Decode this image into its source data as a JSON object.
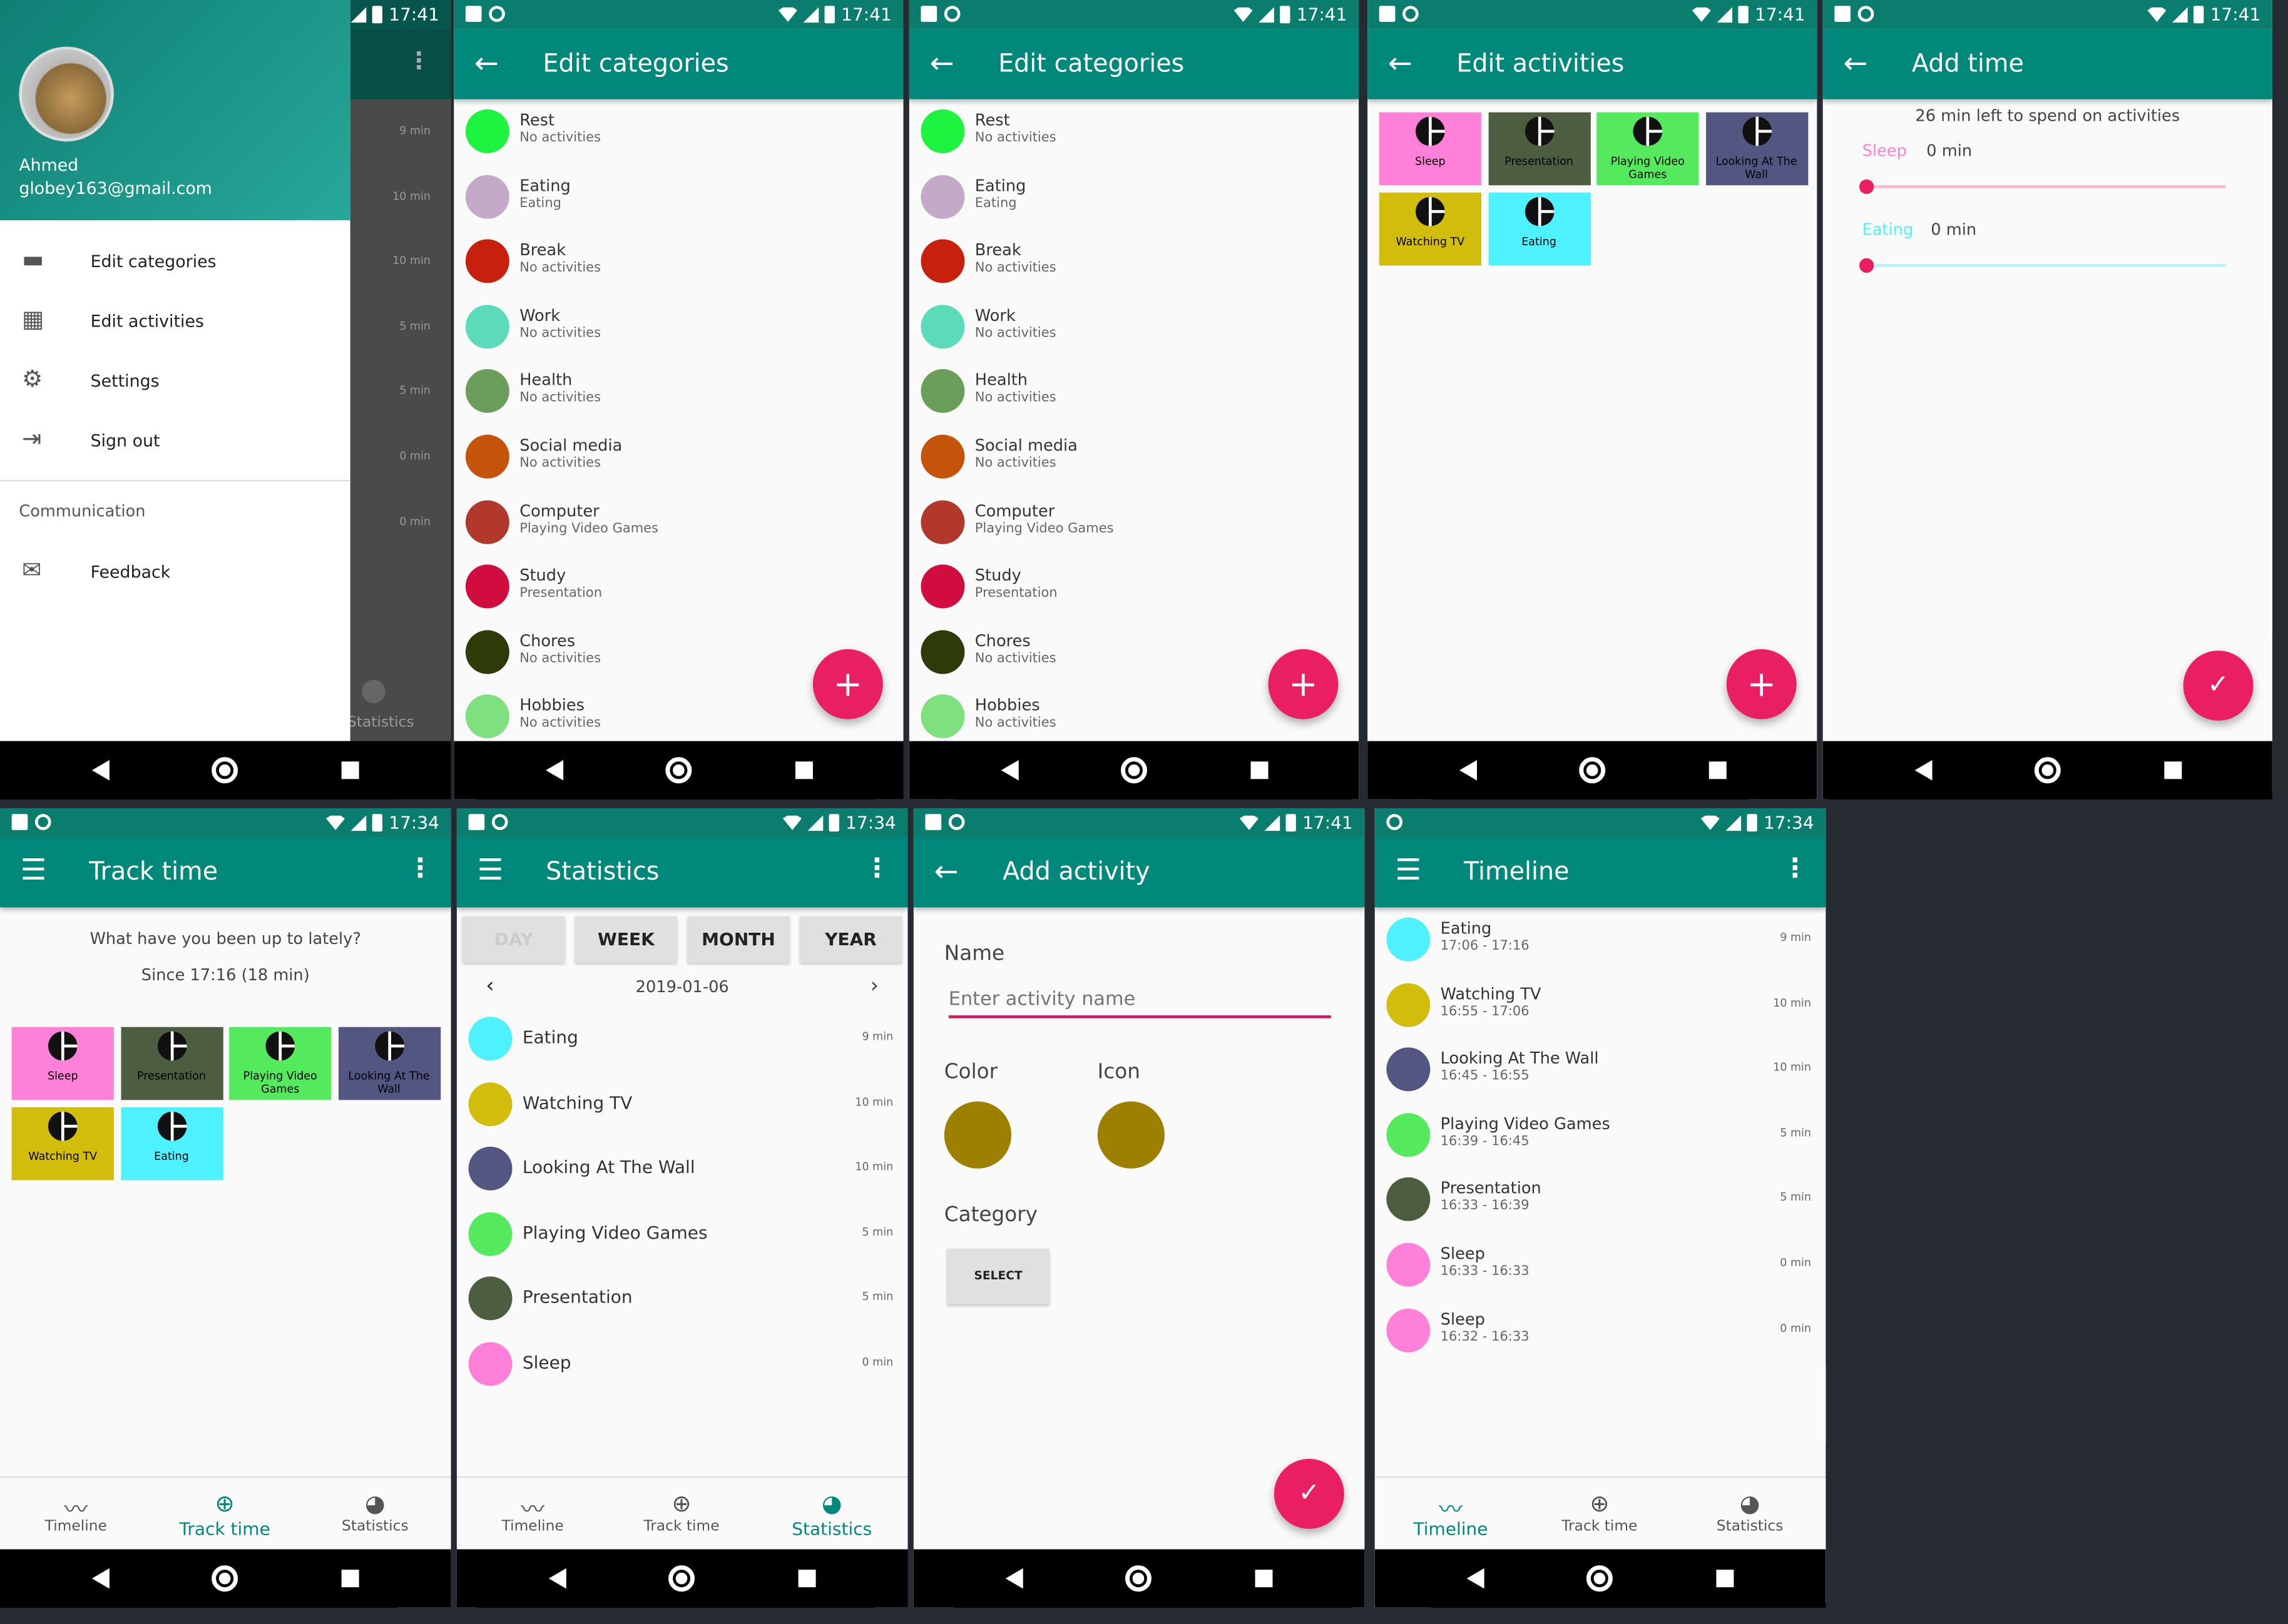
{
  "status": {
    "time_a": "17:41",
    "time_b": "17:34"
  },
  "drawer": {
    "user_name": "Ahmed",
    "user_email": "globey163@gmail.com",
    "items": [
      {
        "icon": "card-icon",
        "label": "Edit categories"
      },
      {
        "icon": "grid-icon",
        "label": "Edit activities"
      },
      {
        "icon": "gear-icon",
        "label": "Settings"
      },
      {
        "icon": "sign-out-icon",
        "label": "Sign out"
      }
    ],
    "section": "Communication",
    "feedback": "Feedback",
    "behind_minutes": [
      "9 min",
      "10 min",
      "10 min",
      "5 min",
      "5 min",
      "0 min",
      "0 min"
    ],
    "behind_tab": "Statistics"
  },
  "edit_categories": {
    "title": "Edit categories",
    "items": [
      {
        "name": "Rest",
        "sub": "No activities",
        "color": "#1ef33f"
      },
      {
        "name": "Eating",
        "sub": "Eating",
        "color": "#c5a9c9"
      },
      {
        "name": "Break",
        "sub": "No activities",
        "color": "#c8200e"
      },
      {
        "name": "Work",
        "sub": "No activities",
        "color": "#5cdbba"
      },
      {
        "name": "Health",
        "sub": "No activities",
        "color": "#6a9e5a"
      },
      {
        "name": "Social media",
        "sub": "No activities",
        "color": "#c6530a"
      },
      {
        "name": "Computer",
        "sub": "Playing Video Games",
        "color": "#b3382c"
      },
      {
        "name": "Study",
        "sub": "Presentation",
        "color": "#d10c3e"
      },
      {
        "name": "Chores",
        "sub": "No activities",
        "color": "#2e3a08"
      },
      {
        "name": "Hobbies",
        "sub": "No activities",
        "color": "#7ee07f"
      }
    ]
  },
  "edit_activities": {
    "title": "Edit activities",
    "tiles": [
      {
        "label": "Sleep",
        "color": "#ff80d9"
      },
      {
        "label": "Presentation",
        "color": "#4d5e40"
      },
      {
        "label": "Playing Video Games",
        "color": "#55ea5e"
      },
      {
        "label": "Looking At The Wall",
        "color": "#535680"
      },
      {
        "label": "Watching TV",
        "color": "#d3bd0c"
      },
      {
        "label": "Eating",
        "color": "#4df1ff"
      }
    ]
  },
  "add_time": {
    "title": "Add time",
    "left": "26 min left to spend on activities",
    "rows": [
      {
        "name": "Sleep",
        "value": "0 min",
        "color": "#ff80d9",
        "level": 0
      },
      {
        "name": "Eating",
        "value": "0 min",
        "color": "#4df1ff",
        "level": 0
      }
    ]
  },
  "track_time": {
    "title": "Track time",
    "question": "What have you been up to lately?",
    "since": "Since 17:16 (18 min)"
  },
  "statistics": {
    "title": "Statistics",
    "tabs": [
      "DAY",
      "WEEK",
      "MONTH",
      "YEAR"
    ],
    "date": "2019-01-06",
    "items": [
      {
        "name": "Eating",
        "min": "9 min",
        "color": "#4df1ff"
      },
      {
        "name": "Watching TV",
        "min": "10 min",
        "color": "#d3bd0c"
      },
      {
        "name": "Looking At The Wall",
        "min": "10 min",
        "color": "#535680"
      },
      {
        "name": "Playing Video Games",
        "min": "5 min",
        "color": "#55ea5e"
      },
      {
        "name": "Presentation",
        "min": "5 min",
        "color": "#4d5e40"
      },
      {
        "name": "Sleep",
        "min": "0 min",
        "color": "#ff80d9"
      }
    ]
  },
  "add_activity": {
    "title": "Add activity",
    "name_label": "Name",
    "name_placeholder": "Enter activity name",
    "color_label": "Color",
    "icon_label": "Icon",
    "category_label": "Category",
    "select_label": "SELECT",
    "swatch": "#9e8000"
  },
  "timeline": {
    "title": "Timeline",
    "items": [
      {
        "name": "Eating",
        "range": "17:06 - 17:16",
        "min": "9 min",
        "color": "#4df1ff"
      },
      {
        "name": "Watching TV",
        "range": "16:55 - 17:06",
        "min": "10 min",
        "color": "#d3bd0c"
      },
      {
        "name": "Looking At The Wall",
        "range": "16:45 - 16:55",
        "min": "10 min",
        "color": "#535680"
      },
      {
        "name": "Playing Video Games",
        "range": "16:39 - 16:45",
        "min": "5 min",
        "color": "#55ea5e"
      },
      {
        "name": "Presentation",
        "range": "16:33 - 16:39",
        "min": "5 min",
        "color": "#4d5e40"
      },
      {
        "name": "Sleep",
        "range": "16:33 - 16:33",
        "min": "0 min",
        "color": "#ff80d9"
      },
      {
        "name": "Sleep",
        "range": "16:32 - 16:33",
        "min": "0 min",
        "color": "#ff80d9"
      }
    ]
  },
  "bottom_nav": [
    "Timeline",
    "Track time",
    "Statistics"
  ]
}
